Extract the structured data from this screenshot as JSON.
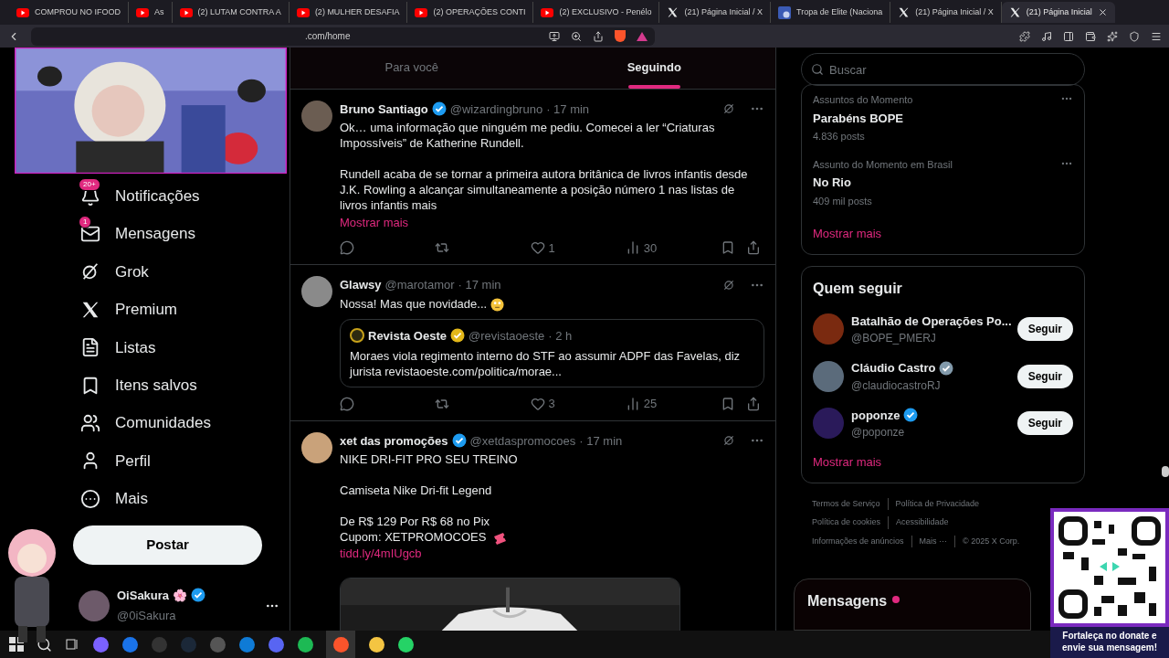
{
  "browser": {
    "tabs": [
      {
        "title": "COMPROU NO IFOOD",
        "kind": "youtube",
        "selected": false
      },
      {
        "title": "As",
        "kind": "youtube",
        "selected": false
      },
      {
        "title": "(2) LUTAM CONTRA A",
        "kind": "youtube",
        "selected": false
      },
      {
        "title": "(2) MULHER DESAFIA",
        "kind": "youtube",
        "selected": false
      },
      {
        "title": "(2) OPERAÇÕES CONTI",
        "kind": "youtube",
        "selected": false
      },
      {
        "title": "(2) EXCLUSIVO - Penélo",
        "kind": "youtube",
        "selected": false
      },
      {
        "title": "(21) Página Inicial / X",
        "kind": "x",
        "selected": false
      },
      {
        "title": "Tropa de Elite (Naciona",
        "kind": "other",
        "selected": false
      },
      {
        "title": "(21) Página Inicial / X",
        "kind": "x",
        "selected": false
      },
      {
        "title": "(21) Página Inicial",
        "kind": "x",
        "selected": true
      }
    ],
    "address": ".com/home"
  },
  "nav": [
    {
      "label": "Notificações",
      "badge": "20+"
    },
    {
      "label": "Mensagens",
      "badge": "1"
    },
    {
      "label": "Grok"
    },
    {
      "label": "Premium"
    },
    {
      "label": "Listas"
    },
    {
      "label": "Itens salvos"
    },
    {
      "label": "Comunidades"
    },
    {
      "label": "Perfil"
    },
    {
      "label": "Mais"
    }
  ],
  "post_button": "Postar",
  "account": {
    "name": "OiSakura 🌸",
    "handle": "@0iSakura",
    "verified": {
      "color": "#1d9bf0"
    }
  },
  "feed_tabs": [
    {
      "label": "Para você",
      "selected": false
    },
    {
      "label": "Seguindo",
      "selected": true
    }
  ],
  "tweets": [
    {
      "name": "Bruno Santiago",
      "verified": {
        "color": "#1d9bf0"
      },
      "handle": "@wizardingbruno",
      "time": "· 17 min",
      "paragraphs": [
        "Ok… uma informação que ninguém me pediu. Comecei a ler “Criaturas Impossíveis” de Katherine Rundell.",
        "Rundell acaba de se tornar a primeira autora britânica de livros infantis desde J.K. Rowling a alcançar simultaneamente a posição número 1 nas listas de livros infantis mais"
      ],
      "more": "Mostrar mais",
      "likes": "1",
      "views": "30"
    },
    {
      "name": "Glawsy",
      "handle": "@marotamor",
      "time": "· 17 min",
      "paragraphs": [
        "Nossa! Mas que novidade..."
      ],
      "emoji": {
        "kind": "rolling-eyes"
      },
      "quote": {
        "name": "Revista Oeste",
        "verified": {
          "color": "#e2b719"
        },
        "handle": "@revistaoeste",
        "time": "· 2 h",
        "text": "Moraes viola regimento interno do STF ao assumir ADPF das Favelas, diz jurista revistaoeste.com/politica/morae..."
      },
      "likes": "3",
      "views": "25"
    },
    {
      "name": "xet das promoções",
      "verified": {
        "color": "#1d9bf0"
      },
      "handle": "@xetdaspromocoes",
      "time": "· 17 min",
      "paragraphs": [
        "NIKE DRI-FIT PRO SEU TREINO",
        "Camiseta Nike Dri-fit Legend",
        "De R$ 129 Por R$ 68 no Pix\nCupom: XETPROMOCOES"
      ],
      "emoji": {
        "kind": "ticket"
      },
      "link": "tidd.ly/4mIUgcb"
    }
  ],
  "search": {
    "placeholder": "Buscar"
  },
  "trends": [
    {
      "context": "Assuntos do Momento",
      "title": "Parabéns BOPE",
      "posts": "4.836 posts"
    },
    {
      "context": "Assunto do Momento em Brasil",
      "title": "No Rio",
      "posts": "409 mil posts"
    }
  ],
  "trends_more": "Mostrar mais",
  "who_to_follow": {
    "title": "Quem seguir",
    "accounts": [
      {
        "name": "Batalhão de Operações Po...",
        "handle": "@BOPE_PMERJ",
        "button": "Seguir"
      },
      {
        "name": "Cláudio Castro",
        "verified": {
          "color": "#829aab"
        },
        "handle": "@claudiocastroRJ",
        "button": "Seguir"
      },
      {
        "name": "poponze",
        "verified": {
          "color": "#1d9bf0"
        },
        "handle": "@poponze",
        "button": "Seguir"
      }
    ],
    "more": "Mostrar mais"
  },
  "footer": [
    [
      "Termos de Serviço",
      "Política de Privacidade"
    ],
    [
      "Política de cookies",
      "Acessibilidade"
    ],
    [
      "Informações de anúncios",
      "Mais ···",
      "© 2025 X Corp."
    ]
  ],
  "messages_drawer": {
    "title": "Mensagens",
    "unread": true
  },
  "donate_overlay": {
    "caption": "Fortaleça no donate e envie sua mensagem!"
  }
}
